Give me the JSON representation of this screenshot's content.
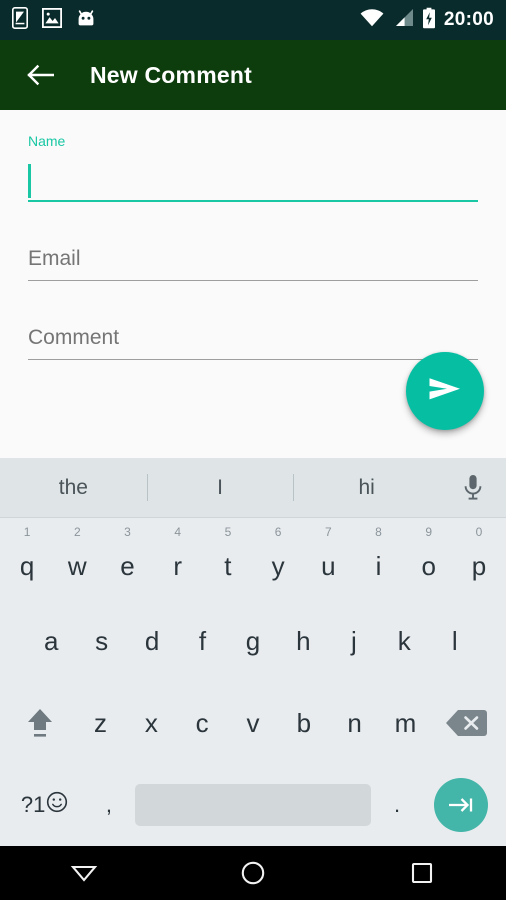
{
  "statusbar": {
    "time": "20:00",
    "icons_left": [
      "device-icon",
      "image-icon",
      "android-head-icon"
    ],
    "icons_right": [
      "wifi-icon",
      "cellular-signal-icon",
      "battery-charging-icon"
    ],
    "background_color": "#0a2b2b"
  },
  "appbar": {
    "back_icon": "arrow-back-icon",
    "title": "New Comment",
    "background_color": "#0d3d0d",
    "title_color": "#ffffff"
  },
  "form": {
    "accent_color": "#19c7a4",
    "background_color": "#fafafa",
    "fields": [
      {
        "name": "name",
        "label": "Name",
        "value": "",
        "placeholder": "Name",
        "focused": true
      },
      {
        "name": "email",
        "label": "Email",
        "value": "",
        "placeholder": "Email",
        "focused": false
      },
      {
        "name": "comment",
        "label": "Comment",
        "value": "",
        "placeholder": "Comment",
        "focused": false
      }
    ],
    "fab": {
      "icon": "send-icon",
      "color": "#06bfa3"
    }
  },
  "keyboard": {
    "background_color": "#e8ecef",
    "suggestion_bar_color": "#dfe4e6",
    "suggestions": [
      "the",
      "I",
      "hi"
    ],
    "mic_icon": "microphone-icon",
    "row1": [
      {
        "letter": "q",
        "num": "1"
      },
      {
        "letter": "w",
        "num": "2"
      },
      {
        "letter": "e",
        "num": "3"
      },
      {
        "letter": "r",
        "num": "4"
      },
      {
        "letter": "t",
        "num": "5"
      },
      {
        "letter": "y",
        "num": "6"
      },
      {
        "letter": "u",
        "num": "7"
      },
      {
        "letter": "i",
        "num": "8"
      },
      {
        "letter": "o",
        "num": "9"
      },
      {
        "letter": "p",
        "num": "0"
      }
    ],
    "row2": [
      {
        "letter": "a"
      },
      {
        "letter": "s"
      },
      {
        "letter": "d"
      },
      {
        "letter": "f"
      },
      {
        "letter": "g"
      },
      {
        "letter": "h"
      },
      {
        "letter": "j"
      },
      {
        "letter": "k"
      },
      {
        "letter": "l"
      }
    ],
    "row3": {
      "shift_icon": "shift-icon",
      "letters": [
        {
          "letter": "z"
        },
        {
          "letter": "x"
        },
        {
          "letter": "c"
        },
        {
          "letter": "v"
        },
        {
          "letter": "b"
        },
        {
          "letter": "n"
        },
        {
          "letter": "m"
        }
      ],
      "delete_icon": "backspace-icon"
    },
    "row4": {
      "symbols_label": "?1",
      "emoji_icon": "emoji-icon",
      "comma": ",",
      "space_label": "",
      "period": ".",
      "enter_icon": "tab-next-icon",
      "enter_color": "#44b5a9"
    }
  },
  "navbar": {
    "background_color": "#000000",
    "buttons": [
      {
        "name": "back",
        "icon": "nav-back-triangle-icon"
      },
      {
        "name": "home",
        "icon": "nav-home-circle-icon"
      },
      {
        "name": "recents",
        "icon": "nav-recents-square-icon"
      }
    ]
  }
}
